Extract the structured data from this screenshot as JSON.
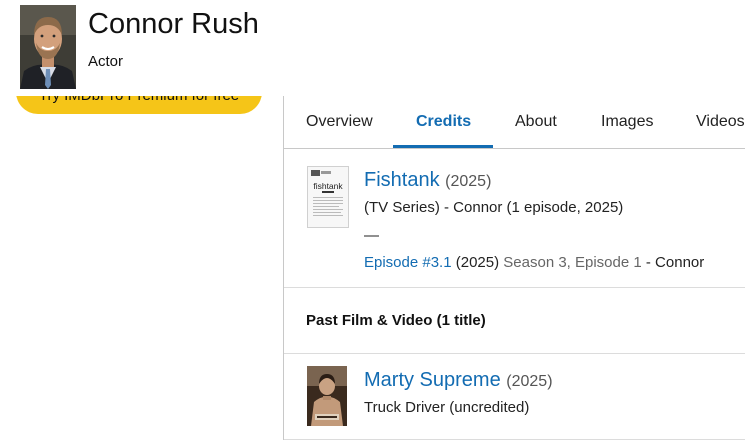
{
  "person": {
    "name": "Connor Rush",
    "role": "Actor"
  },
  "promo": {
    "label": "Try IMDbPro Premium for free"
  },
  "tabs": [
    {
      "label": "Overview",
      "active": false
    },
    {
      "label": "Credits",
      "active": true
    },
    {
      "label": "About",
      "active": false
    },
    {
      "label": "Images",
      "active": false
    },
    {
      "label": "Videos",
      "active": false
    }
  ],
  "credits": {
    "current": {
      "title": "Fishtank",
      "year": "(2025)",
      "description": "(TV Series) - Connor (1 episode, 2025)",
      "separator": "—",
      "episode_link": "Episode #3.1",
      "episode_year": "(2025)",
      "episode_season": "Season 3, Episode 1",
      "episode_role": "- Connor",
      "thumb_text": "fishtank"
    },
    "past_section_title": "Past Film & Video (1 title)",
    "past": {
      "title": "Marty Supreme",
      "year": "(2025)",
      "description": "Truck Driver (uncredited)"
    }
  },
  "colors": {
    "link": "#136cb2",
    "accent_yellow": "#f5c518"
  }
}
